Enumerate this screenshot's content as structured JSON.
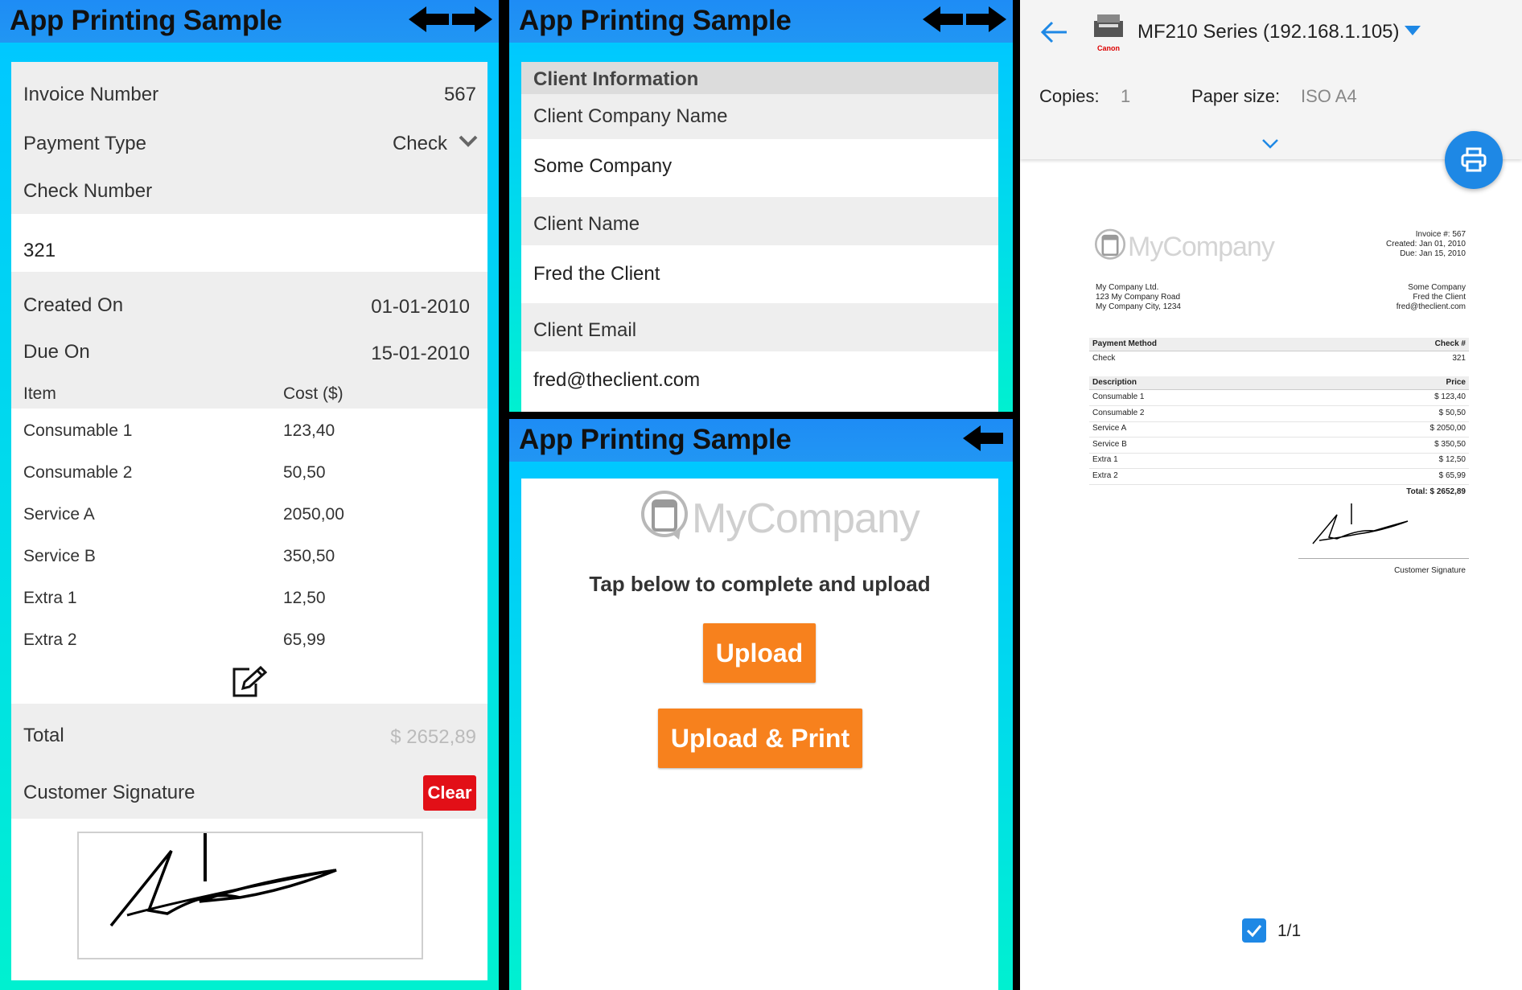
{
  "app": {
    "title": "App Printing Sample"
  },
  "invoice": {
    "number_label": "Invoice Number",
    "number_value": "567",
    "payment_type_label": "Payment Type",
    "payment_type_value": "Check",
    "check_number_label": "Check Number",
    "check_number_value": "321",
    "created_label": "Created On",
    "created_value": "01-01-2010",
    "due_label": "Due On",
    "due_value": "15-01-2010",
    "item_header": "Item",
    "cost_header": "Cost ($)",
    "items": [
      {
        "name": "Consumable 1",
        "cost": "123,40"
      },
      {
        "name": "Consumable 2",
        "cost": "50,50"
      },
      {
        "name": "Service A",
        "cost": "2050,00"
      },
      {
        "name": "Service B",
        "cost": "350,50"
      },
      {
        "name": "Extra 1",
        "cost": "12,50"
      },
      {
        "name": "Extra 2",
        "cost": "65,99"
      }
    ],
    "total_label": "Total",
    "total_value": "$ 2652,89",
    "signature_label": "Customer Signature",
    "clear_label": "Clear"
  },
  "client": {
    "section_header": "Client Information",
    "company_label": "Client Company Name",
    "company_value": "Some Company",
    "name_label": "Client Name",
    "name_value": "Fred the Client",
    "email_label": "Client Email",
    "email_value": "fred@theclient.com"
  },
  "upload": {
    "logo_text": "MyCompany",
    "prompt": "Tap below to complete and upload",
    "upload_label": "Upload",
    "upload_print_label": "Upload & Print"
  },
  "print": {
    "printer_name": "MF210 Series (192.168.1.105)",
    "printer_brand": "Canon",
    "copies_label": "Copies:",
    "copies_value": "1",
    "paper_label": "Paper size:",
    "paper_value": "ISO A4",
    "page_counter": "1/1",
    "preview": {
      "logo_text": "MyCompany",
      "invoice_no": "Invoice #: 567",
      "created": "Created: Jan 01, 2010",
      "due": "Due: Jan 15, 2010",
      "from_lines": [
        "My Company Ltd.",
        "123 My Company Road",
        "My Company City, 1234"
      ],
      "to_lines": [
        "Some Company",
        "Fred the Client",
        "fred@theclient.com"
      ],
      "payment_method_header": "Payment Method",
      "check_header": "Check #",
      "payment_method": "Check",
      "check_no": "321",
      "description_header": "Description",
      "price_header": "Price",
      "items": [
        {
          "name": "Consumable 1",
          "price": "$ 123,40"
        },
        {
          "name": "Consumable 2",
          "price": "$ 50,50"
        },
        {
          "name": "Service A",
          "price": "$ 2050,00"
        },
        {
          "name": "Service B",
          "price": "$ 350,50"
        },
        {
          "name": "Extra 1",
          "price": "$ 12,50"
        },
        {
          "name": "Extra 2",
          "price": "$ 65,99"
        }
      ],
      "total": "Total: $ 2652,89",
      "signature_caption": "Customer Signature"
    }
  },
  "colors": {
    "appbar": "#2196f3",
    "gradient_top": "#00c8ff",
    "gradient_bottom": "#00f0d0",
    "orange": "#f7811d",
    "clear_red": "#e20f17",
    "print_blue": "#1e88e5"
  }
}
